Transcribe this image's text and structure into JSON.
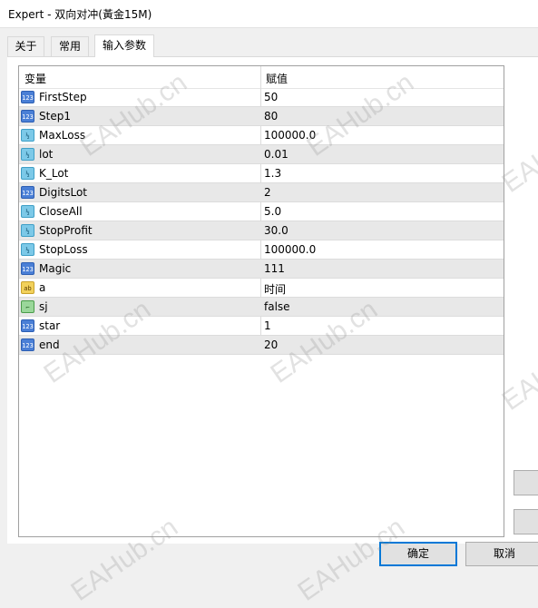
{
  "window": {
    "title": "Expert - 双向对冲(黃金15M)"
  },
  "tabs": [
    {
      "label": "关于"
    },
    {
      "label": "常用"
    },
    {
      "label": "输入参数"
    }
  ],
  "grid": {
    "headers": {
      "variable": "变量",
      "value": "赋值"
    },
    "rows": [
      {
        "type": "int",
        "icon": "int-type-icon",
        "name": "FirstStep",
        "value": "50"
      },
      {
        "type": "int",
        "icon": "int-type-icon",
        "name": "Step1",
        "value": "80"
      },
      {
        "type": "double",
        "icon": "double-type-icon",
        "name": "MaxLoss",
        "value": "100000.0"
      },
      {
        "type": "double",
        "icon": "double-type-icon",
        "name": "lot",
        "value": "0.01"
      },
      {
        "type": "double",
        "icon": "double-type-icon",
        "name": "K_Lot",
        "value": "1.3"
      },
      {
        "type": "int",
        "icon": "int-type-icon",
        "name": "DigitsLot",
        "value": "2"
      },
      {
        "type": "double",
        "icon": "double-type-icon",
        "name": "CloseAll",
        "value": "5.0"
      },
      {
        "type": "double",
        "icon": "double-type-icon",
        "name": "StopProfit",
        "value": "30.0"
      },
      {
        "type": "double",
        "icon": "double-type-icon",
        "name": "StopLoss",
        "value": "100000.0"
      },
      {
        "type": "int",
        "icon": "int-type-icon",
        "name": "Magic",
        "value": "111"
      },
      {
        "type": "string",
        "icon": "string-type-icon",
        "name": "a",
        "value": "时间"
      },
      {
        "type": "bool",
        "icon": "bool-type-icon",
        "name": "sj",
        "value": "false"
      },
      {
        "type": "int",
        "icon": "int-type-icon",
        "name": "star",
        "value": "1"
      },
      {
        "type": "int",
        "icon": "int-type-icon",
        "name": "end",
        "value": "20"
      }
    ]
  },
  "buttons": {
    "ok": "确定",
    "cancel": "取消"
  },
  "watermark": "EAHub.cn",
  "colors": {
    "accent": "#0078d7",
    "alt_row": "#e8e8e8"
  }
}
